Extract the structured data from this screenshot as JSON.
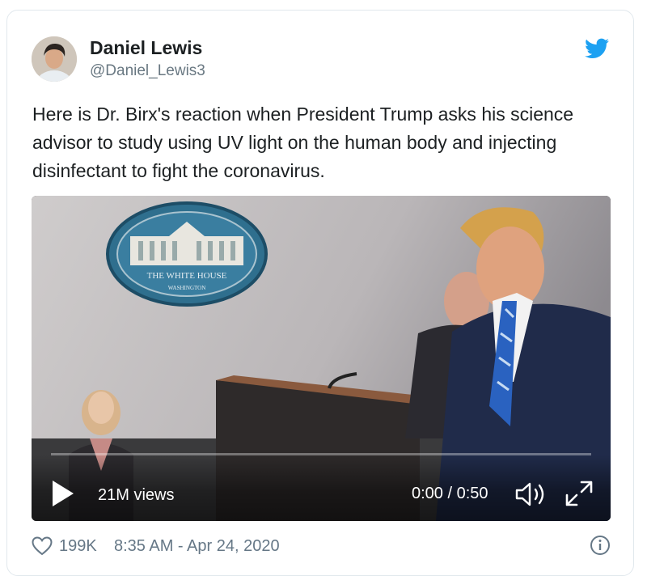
{
  "tweet": {
    "author": {
      "name": "Daniel Lewis",
      "handle": "@Daniel_Lewis3"
    },
    "text_lines": [
      "Here is Dr. Birx's reaction when President Trump asks his science",
      "advisor to study using UV light on the human body and injecting",
      "disinfectant to fight the coronavirus."
    ],
    "media": {
      "seal_text_line1": "THE WHITE HOUSE",
      "seal_text_line2": "WASHINGTON",
      "views": "21M views",
      "time": "0:00 / 0:50",
      "progress": 0.0
    },
    "footer": {
      "likes": "199K",
      "timestamp": "8:35 AM - Apr 24, 2020"
    }
  },
  "icons": [
    "avatar",
    "twitter-bird-icon",
    "play-icon",
    "volume-icon",
    "fullscreen-icon",
    "heart-icon",
    "info-icon"
  ],
  "colors": {
    "brand": "#1da1f2",
    "text": "#1c2022",
    "muted": "#657786",
    "border": "#e1e8ed"
  }
}
